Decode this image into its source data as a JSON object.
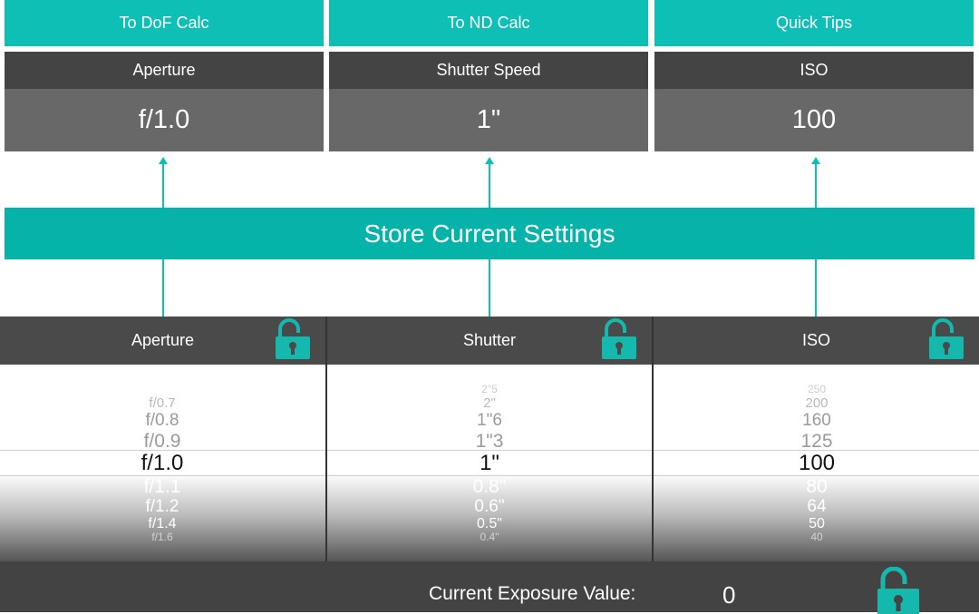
{
  "tabs": [
    {
      "label": "To DoF Calc"
    },
    {
      "label": "To ND Calc"
    },
    {
      "label": "Quick Tips"
    }
  ],
  "stored": [
    {
      "header": "Aperture",
      "value": "f/1.0"
    },
    {
      "header": "Shutter Speed",
      "value": "1\""
    },
    {
      "header": "ISO",
      "value": "100"
    }
  ],
  "store_button": "Store Current Settings",
  "pickers": [
    {
      "header": "Aperture",
      "rows": [
        "f/0.7",
        "f/0.8",
        "f/0.9",
        "f/1.0",
        "f/1.1",
        "f/1.2",
        "f/1.4",
        "f/1.6"
      ]
    },
    {
      "header": "Shutter",
      "rows": [
        "2\"5",
        "2\"",
        "1\"6",
        "1\"3",
        "1\"",
        "0.8\"",
        "0.6\"",
        "0.5\"",
        "0.4\""
      ]
    },
    {
      "header": "ISO",
      "rows": [
        "250",
        "200",
        "160",
        "125",
        "100",
        "80",
        "64",
        "50",
        "40"
      ]
    }
  ],
  "footer": {
    "label": "Current Exposure Value:",
    "value": "0"
  },
  "colors": {
    "accent": "#0ebfb6",
    "dark_header": "#444444",
    "stored_value_bg": "#686868"
  },
  "icons": {
    "lock": "unlocked-padlock-icon"
  }
}
